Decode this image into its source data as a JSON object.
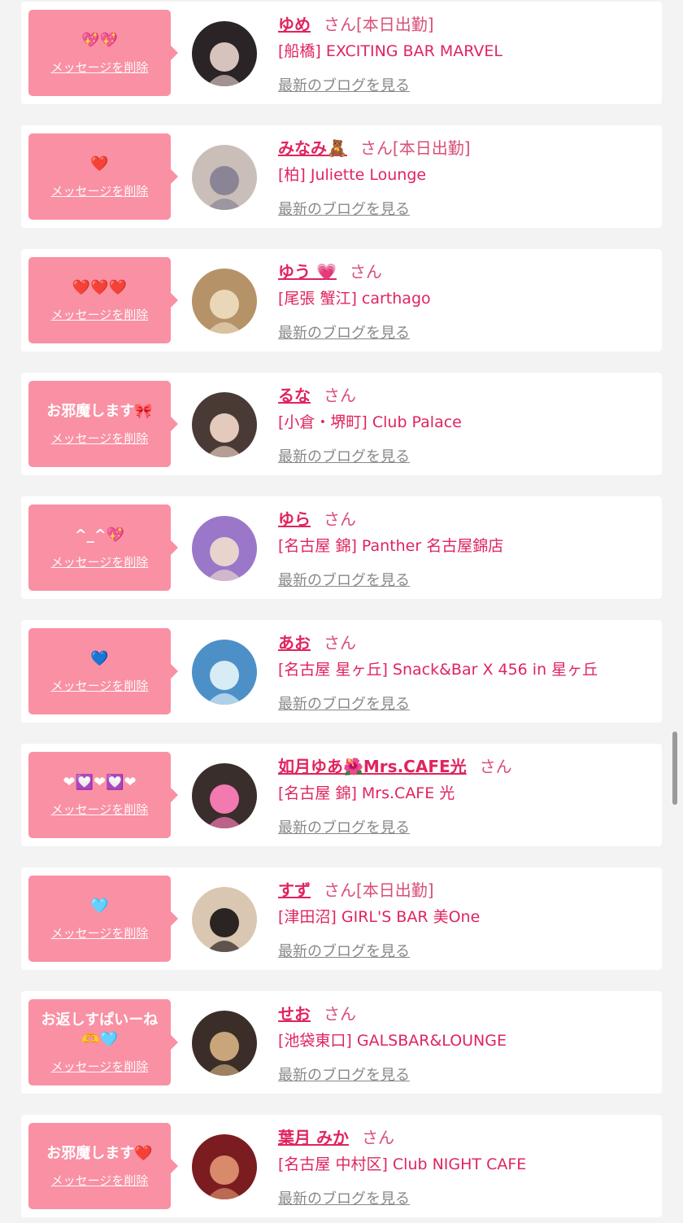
{
  "colors": {
    "accent": "#e0245e",
    "bubble": "#f990a4",
    "background": "#f3f3f3"
  },
  "labels": {
    "delete": "メッセージを削除",
    "blog": "最新のブログを見る",
    "suffix": "さん"
  },
  "entries": [
    {
      "message": "💖💖",
      "name": "ゆめ",
      "status": "[本日出勤]",
      "store": "[船橋] EXCITING BAR MARVEL",
      "avatar": "avatar-photo",
      "avatar_colors": [
        "#2b2426",
        "#d6c3bd"
      ]
    },
    {
      "message": "❤️",
      "name": "みなみ🧸",
      "status": "[本日出勤]",
      "store": "[柏] Juliette Lounge",
      "avatar": "avatar-photo",
      "avatar_colors": [
        "#c9bfb8",
        "#8a8596"
      ]
    },
    {
      "message": "❤️❤️❤️",
      "name": "ゆう 💗",
      "status": "",
      "store": "[尾張 蟹江] carthago",
      "avatar": "avatar-photo",
      "avatar_colors": [
        "#b59268",
        "#e9d7b8"
      ]
    },
    {
      "message": "お邪魔します🎀",
      "name": "るな",
      "status": "",
      "store": "[小倉・堺町] Club Palace",
      "avatar": "avatar-photo",
      "avatar_colors": [
        "#4a3a36",
        "#e4c9bd"
      ]
    },
    {
      "message": "^_^💖",
      "name": "ゆら",
      "status": "",
      "store": "[名古屋 錦] Panther 名古屋錦店",
      "avatar": "avatar-photo",
      "avatar_colors": [
        "#9b77c9",
        "#e8d3cd"
      ]
    },
    {
      "message": "💙",
      "name": "あお",
      "status": "",
      "store": "[名古屋 星ヶ丘] Snack&Bar X 456 in 星ヶ丘",
      "avatar": "avatar-photo",
      "avatar_colors": [
        "#4d90c8",
        "#d7ecf4"
      ]
    },
    {
      "message": "❤💟❤💟❤",
      "name": "如月ゆあ🌺Mrs.CAFE光",
      "status": "",
      "store": "[名古屋 錦] Mrs.CAFE 光",
      "avatar": "avatar-photo",
      "avatar_colors": [
        "#3a2e2c",
        "#f27ab0"
      ]
    },
    {
      "message": "🩵",
      "name": "すず",
      "status": "[本日出勤]",
      "store": "[津田沼] GIRL'S BAR 美One",
      "avatar": "avatar-photo",
      "avatar_colors": [
        "#d9c7b1",
        "#2a2422"
      ]
    },
    {
      "message": "お返しすぱいーね\n🫶🩵",
      "name": "せお",
      "status": "",
      "store": "[池袋東口] GALSBAR&LOUNGE",
      "avatar": "avatar-photo",
      "avatar_colors": [
        "#3b2e28",
        "#c9a57c"
      ]
    },
    {
      "message": "お邪魔します❤️",
      "name": "葉月 みか",
      "status": "",
      "store": "[名古屋 中村区] Club NIGHT CAFE",
      "avatar": "avatar-photo",
      "avatar_colors": [
        "#7a1c20",
        "#d98a6a"
      ]
    }
  ]
}
